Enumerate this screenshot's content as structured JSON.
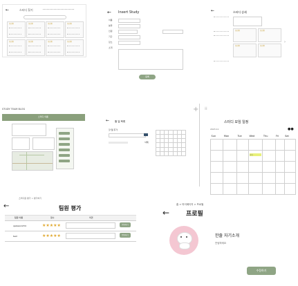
{
  "top_left": {
    "title": "스터디 찾기",
    "search_placeholder": "검색",
    "cards": [
      {
        "tag": "모집중"
      },
      {
        "tag": "모집중"
      },
      {
        "tag": "모집중"
      },
      {
        "tag": "모집중"
      },
      {
        "tag": "모집중"
      },
      {
        "tag": "모집중"
      },
      {
        "tag": "모집중"
      },
      {
        "tag": "모집중"
      }
    ]
  },
  "insert_study": {
    "title": "Insert Study",
    "labels": [
      "이름",
      "분류",
      "인원",
      "기간",
      "장소",
      "소개"
    ],
    "submit": "등록"
  },
  "top_right": {
    "title": "스터디 상세",
    "items": [
      "모집중",
      "모집중",
      "모집중",
      "모집중"
    ]
  },
  "study_page": {
    "title": "STUDY TEAM BLOG",
    "banner": "스터디 이름"
  },
  "todo": {
    "title": "할 일 목록",
    "input_label": "할 일 추가",
    "add": "추가",
    "delete": "삭제"
  },
  "calendar": {
    "title": "스터디 모임 일정",
    "month": "2023.11",
    "weekdays": [
      "Sun",
      "Mon",
      "Tue",
      "Wed",
      "Thu",
      "Fri",
      "Sat"
    ],
    "highlight": "모임"
  },
  "evaluation": {
    "breadcrumb": "스터디원 평가 > 평가하기",
    "title": "팀원 평가",
    "headers": [
      "팀원 이름",
      "점수",
      "의견"
    ],
    "rows": [
      {
        "name": "qazwsx1234",
        "button": "평가하기"
      },
      {
        "name": "test",
        "button": "평가하기"
      }
    ]
  },
  "profile": {
    "breadcrumb": "홈 > 마이페이지 > 프로필",
    "title": "프로필",
    "intro": "한줄 자기소개",
    "sub": "안녕하세요",
    "edit": "수정하기"
  }
}
